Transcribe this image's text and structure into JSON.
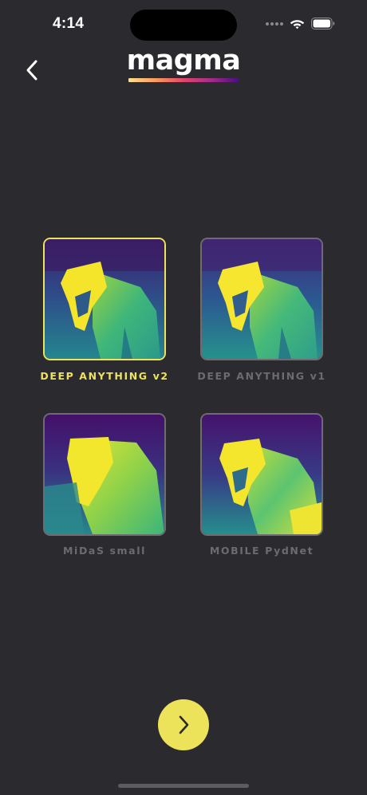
{
  "status_bar": {
    "time": "4:14",
    "wifi_icon": "wifi-icon",
    "battery_icon": "battery-icon"
  },
  "header": {
    "back_icon": "chevron-left-icon",
    "logo_text": "magma"
  },
  "models": [
    {
      "label": "DEEP ANYTHING v2",
      "selected": true
    },
    {
      "label": "DEEP ANYTHING v1",
      "selected": false
    },
    {
      "label": "MiDaS small",
      "selected": false
    },
    {
      "label": "MOBILE PydNet",
      "selected": false
    }
  ],
  "next_button": {
    "icon": "chevron-right-icon"
  },
  "colors": {
    "background": "#2b2a2e",
    "accent": "#ede35a",
    "inactive_label": "#6c6b70",
    "card_border": "#6e6c70"
  }
}
